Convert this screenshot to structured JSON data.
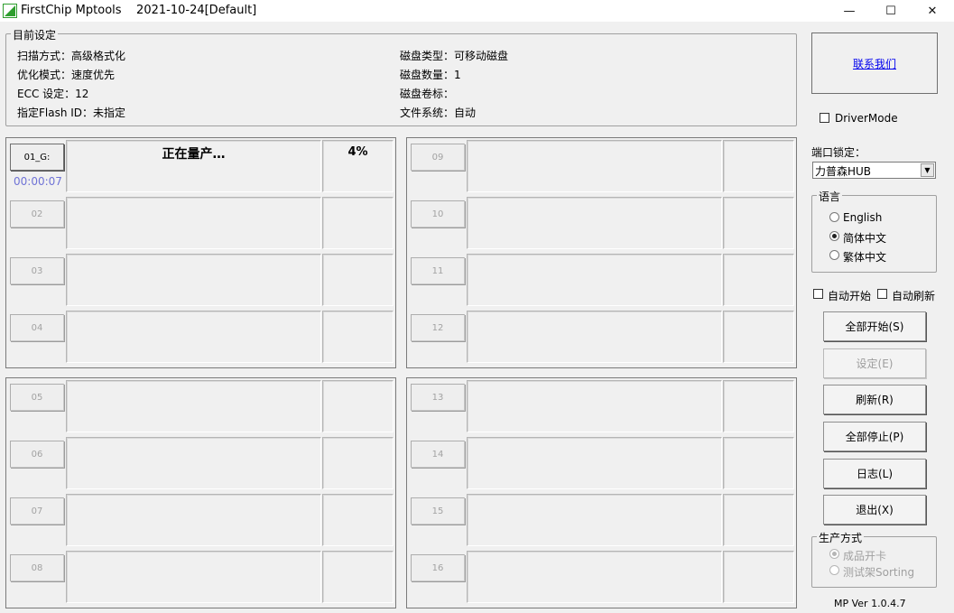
{
  "window": {
    "title": "FirstChip Mptools    2021-10-24[Default]",
    "minimize_glyph": "—",
    "maximize_glyph": "☐",
    "close_glyph": "✕"
  },
  "settings": {
    "group_label": "目前设定",
    "scan_mode": "扫描方式：高级格式化",
    "optimize_mode": "优化模式：速度优先",
    "ecc": "ECC 设定：12",
    "flash_id": "指定Flash ID：未指定",
    "disk_type": "磁盘类型：可移动磁盘",
    "disk_count": "磁盘数量：1",
    "volume_label": "磁盘卷标：",
    "file_system": "文件系统：自动"
  },
  "ports": [
    {
      "label": "01_G:",
      "active": true,
      "status": "正在量产…",
      "percent": "4%",
      "timer": "00:00:07"
    },
    {
      "label": "02",
      "active": false,
      "status": "",
      "percent": "",
      "timer": ""
    },
    {
      "label": "03",
      "active": false,
      "status": "",
      "percent": "",
      "timer": ""
    },
    {
      "label": "04",
      "active": false,
      "status": "",
      "percent": "",
      "timer": ""
    },
    {
      "label": "05",
      "active": false,
      "status": "",
      "percent": "",
      "timer": ""
    },
    {
      "label": "06",
      "active": false,
      "status": "",
      "percent": "",
      "timer": ""
    },
    {
      "label": "07",
      "active": false,
      "status": "",
      "percent": "",
      "timer": ""
    },
    {
      "label": "08",
      "active": false,
      "status": "",
      "percent": "",
      "timer": ""
    },
    {
      "label": "09",
      "active": false,
      "status": "",
      "percent": "",
      "timer": ""
    },
    {
      "label": "10",
      "active": false,
      "status": "",
      "percent": "",
      "timer": ""
    },
    {
      "label": "11",
      "active": false,
      "status": "",
      "percent": "",
      "timer": ""
    },
    {
      "label": "12",
      "active": false,
      "status": "",
      "percent": "",
      "timer": ""
    },
    {
      "label": "13",
      "active": false,
      "status": "",
      "percent": "",
      "timer": ""
    },
    {
      "label": "14",
      "active": false,
      "status": "",
      "percent": "",
      "timer": ""
    },
    {
      "label": "15",
      "active": false,
      "status": "",
      "percent": "",
      "timer": ""
    },
    {
      "label": "16",
      "active": false,
      "status": "",
      "percent": "",
      "timer": ""
    }
  ],
  "sidebar": {
    "contact_link": "联系我们",
    "driver_mode_label": "DriverMode",
    "driver_mode_checked": false,
    "port_lock_label": "端口锁定：",
    "port_lock_value": "力普森HUB",
    "language_group_label": "语言",
    "languages": [
      {
        "label": "English",
        "selected": false
      },
      {
        "label": "简体中文",
        "selected": true
      },
      {
        "label": "繁体中文",
        "selected": false
      }
    ],
    "auto_start_label": "自动开始",
    "auto_refresh_label": "自动刷新",
    "buttons": [
      {
        "label": "全部开始(S)",
        "enabled": true
      },
      {
        "label": "设定(E)",
        "enabled": false
      },
      {
        "label": "刷新(R)",
        "enabled": true
      },
      {
        "label": "全部停止(P)",
        "enabled": true
      },
      {
        "label": "日志(L)",
        "enabled": true
      },
      {
        "label": "退出(X)",
        "enabled": true
      }
    ],
    "production_group_label": "生产方式",
    "production_modes": [
      {
        "label": "成品开卡",
        "selected": true
      },
      {
        "label": "测试架Sorting",
        "selected": false
      }
    ],
    "version": "MP Ver 1.0.4.7"
  },
  "colors": {
    "timer": "#6f73d6",
    "link": "#0000ee",
    "icon_green": "#2e9e2e"
  }
}
